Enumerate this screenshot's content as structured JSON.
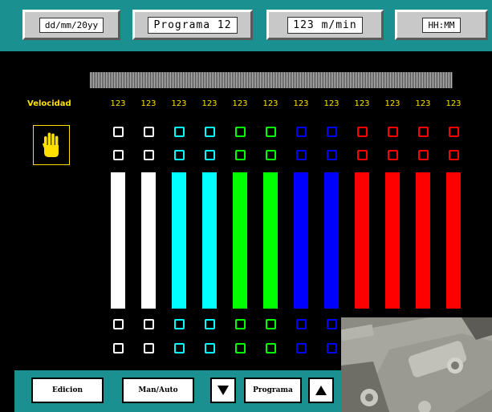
{
  "header": {
    "date": "dd/mm/20yy",
    "program": "Programa 12",
    "speed": "123 m/min",
    "time": "HH:MM"
  },
  "panel": {
    "velocity_label": "Velocidad",
    "speed_values": [
      "123",
      "123",
      "123",
      "123",
      "123",
      "123",
      "123",
      "123",
      "123",
      "123",
      "123",
      "123"
    ],
    "channel_colors": [
      "#ffffff",
      "#ffffff",
      "#00ffff",
      "#00ffff",
      "#00ff00",
      "#00ff00",
      "#0000ff",
      "#0000ff",
      "#ff0000",
      "#ff0000",
      "#ff0000",
      "#ff0000"
    ]
  },
  "footer": {
    "edicion_label": "Edicion",
    "man_auto_label": "Man/Auto",
    "programa_label": "Programa"
  },
  "icons": {
    "hand": "hand-icon",
    "down": "arrow-down-icon",
    "up": "arrow-up-icon"
  }
}
